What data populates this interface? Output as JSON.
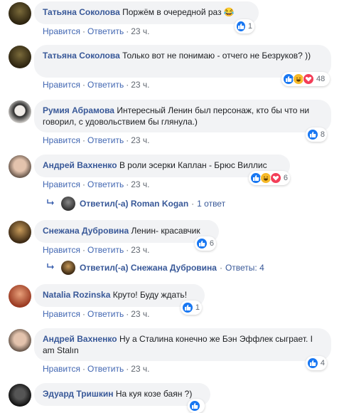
{
  "labels": {
    "like": "Нравится",
    "reply": "Ответить",
    "sep": "·"
  },
  "comments": [
    {
      "author": "Татьяна Соколова",
      "text": "Поржём в очередной раз 😂",
      "time": "23 ч.",
      "reactions": [
        "like"
      ],
      "count": "1"
    },
    {
      "author": "Татьяна Соколова",
      "text": "Только вот не понимаю - отчего не Безруков? ))",
      "time": "23 ч.",
      "reactions": [
        "like",
        "haha",
        "love"
      ],
      "count": "48"
    },
    {
      "author": "Румия Абрамова",
      "text": "Интересный Ленин был персонаж, кто бы что ни говорил, с удовольствием бы глянула.)",
      "time": "23 ч.",
      "reactions": [
        "like"
      ],
      "count": "8"
    },
    {
      "author": "Андрей Вахненко",
      "text": "В роли эсерки Каплан - Брюс Виллис",
      "time": "23 ч.",
      "reactions": [
        "like",
        "haha",
        "love"
      ],
      "count": "6"
    },
    {
      "author": "Снежана Дубровина",
      "text": "Ленин- красавчик",
      "time": "23 ч.",
      "reactions": [
        "like"
      ],
      "count": "6"
    },
    {
      "author": "Natalia Rozinska",
      "text": "Круто! Буду ждать!",
      "time": "23 ч.",
      "reactions": [
        "like"
      ],
      "count": "1"
    },
    {
      "author": "Андрей Вахненко",
      "text": "Ну а Сталина конечно же Бэн Эффлек сыграет. I am Stalın",
      "time": "23 ч.",
      "reactions": [
        "like"
      ],
      "count": "4"
    },
    {
      "author": "Эдуард Тришкин",
      "text": "На куя козе баян ?)",
      "time": "",
      "reactions": [
        "like"
      ],
      "count": ""
    }
  ],
  "replies": [
    {
      "text": "Ответил(-а) Roman Kogan",
      "extra": "1 ответ"
    },
    {
      "text": "Ответил(-а) Снежана Дубровина",
      "extra": "Ответы: 4"
    }
  ],
  "colors": {
    "author": "#385898",
    "link": "#4267b2",
    "bubble": "#f2f3f5",
    "like": "#1877f2",
    "haha": "#f7b928",
    "love": "#f33e58"
  }
}
